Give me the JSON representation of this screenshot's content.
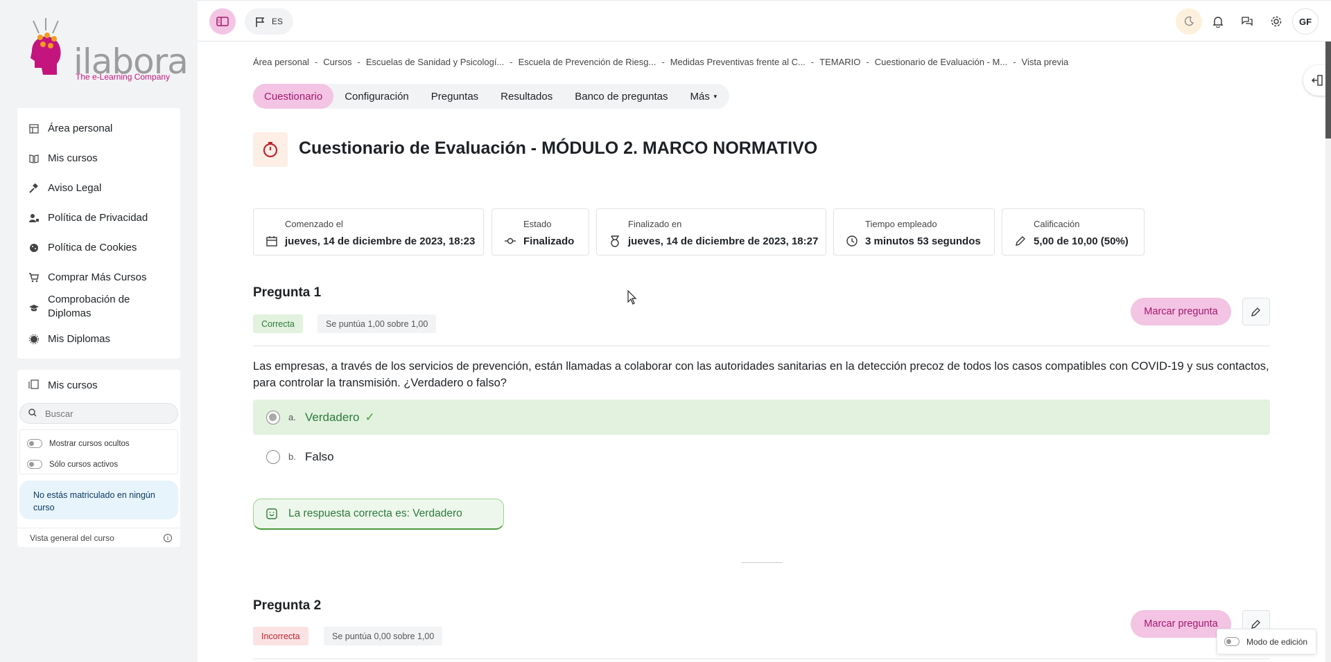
{
  "brand": {
    "logo_word": "ilabora",
    "tagline": "The e-Learning Company"
  },
  "topbar": {
    "language": "ES",
    "user_initials": "GF"
  },
  "sidebar": {
    "nav": [
      {
        "label": "Área personal",
        "icon": "dashboard-icon"
      },
      {
        "label": "Mis cursos",
        "icon": "book-icon"
      },
      {
        "label": "Aviso Legal",
        "icon": "gavel-icon"
      },
      {
        "label": "Política de Privacidad",
        "icon": "user-lock-icon"
      },
      {
        "label": "Política de Cookies",
        "icon": "cookie-icon"
      },
      {
        "label": "Comprar Más Cursos",
        "icon": "cart-icon"
      },
      {
        "label": "Comprobación de Diplomas",
        "icon": "graduation-cap-icon"
      },
      {
        "label": "Mis Diplomas",
        "icon": "certificate-icon"
      }
    ],
    "courses_block": {
      "title": "Mis cursos",
      "search_placeholder": "Buscar",
      "filter_hidden": "Mostrar cursos ocultos",
      "filter_active": "Sólo cursos activos",
      "notice": "No estás matriculado en ningún curso",
      "overview": "Vista general del curso"
    }
  },
  "breadcrumb": [
    "Área personal",
    "Cursos",
    "Escuelas de Sanidad y Psicologí...",
    "Escuela de Prevención de Riesg...",
    "Medidas Preventivas frente al C...",
    "TEMARIO",
    "Cuestionario de Evaluación - M...",
    "Vista previa"
  ],
  "tabs": [
    "Cuestionario",
    "Configuración",
    "Preguntas",
    "Resultados",
    "Banco de preguntas",
    "Más"
  ],
  "page_title": "Cuestionario de Evaluación - MÓDULO 2. MARCO NORMATIVO",
  "summary": [
    {
      "label": "Comenzado el",
      "value": "jueves, 14 de diciembre de 2023, 18:23",
      "icon": "calendar-icon"
    },
    {
      "label": "Estado",
      "value": "Finalizado",
      "icon": "commit-icon"
    },
    {
      "label": "Finalizado en",
      "value": "jueves, 14 de diciembre de 2023, 18:27",
      "icon": "medal-icon"
    },
    {
      "label": "Tiempo empleado",
      "value": "3 minutos 53 segundos",
      "icon": "clock-icon"
    },
    {
      "label": "Calificación",
      "value": "5,00 de 10,00 (50%)",
      "icon": "pencil-icon"
    }
  ],
  "questions": [
    {
      "title": "Pregunta 1",
      "status": "Correcta",
      "score": "Se puntúa 1,00 sobre 1,00",
      "flag_label": "Marcar pregunta",
      "text": "Las empresas, a través de los servicios de prevención, están llamadas a colaborar con las autoridades sanitarias en la detección precoz de todos los casos compatibles con COVID-19 y sus contactos, para controlar la transmisión. ¿Verdadero o falso?",
      "options": [
        {
          "letter": "a.",
          "text": "Verdadero"
        },
        {
          "letter": "b.",
          "text": "Falso"
        }
      ],
      "feedback": "La respuesta correcta es: Verdadero"
    },
    {
      "title": "Pregunta 2",
      "status": "Incorrecta",
      "score": "Se puntúa 0,00 sobre 1,00",
      "flag_label": "Marcar pregunta"
    }
  ],
  "edit_mode_label": "Modo de edición",
  "colors": {
    "accent": "#c4157e",
    "accent_light": "#f3c4e3",
    "correct_bg": "#e2f2df",
    "correct_text": "#2d7a3b",
    "incorrect_bg": "#fbe3e4",
    "incorrect_text": "#c0232d"
  }
}
